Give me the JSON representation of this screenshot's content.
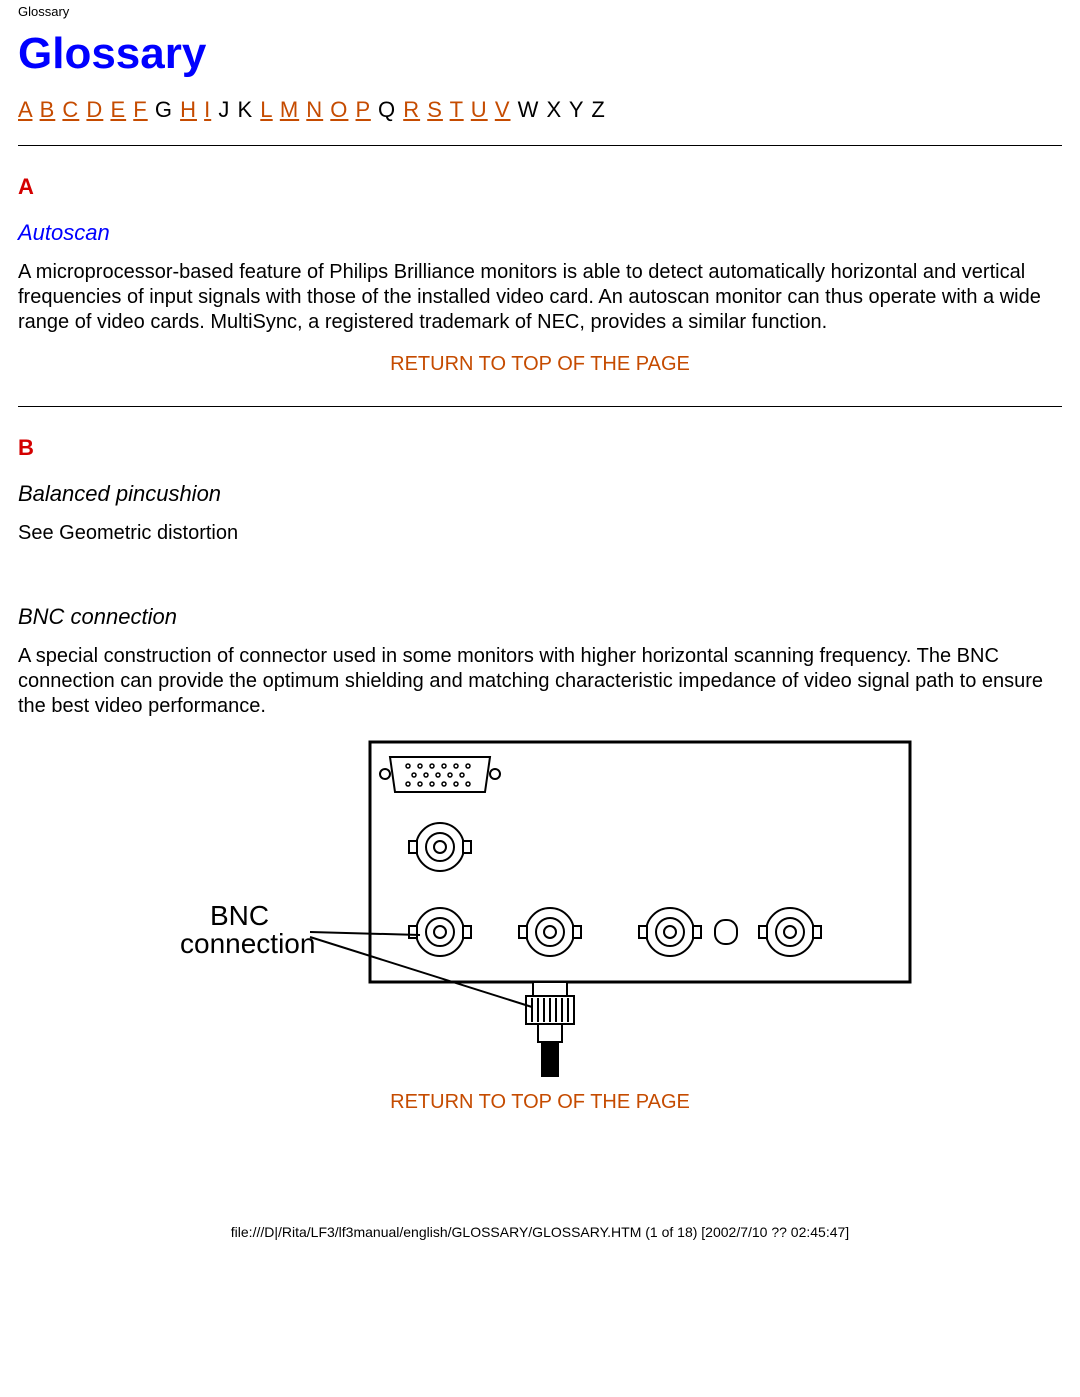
{
  "header_small": "Glossary",
  "title": "Glossary",
  "alpha_index": [
    {
      "letter": "A",
      "linked": true
    },
    {
      "letter": "B",
      "linked": true
    },
    {
      "letter": "C",
      "linked": true
    },
    {
      "letter": "D",
      "linked": true
    },
    {
      "letter": "E",
      "linked": true
    },
    {
      "letter": "F",
      "linked": true
    },
    {
      "letter": "G",
      "linked": false
    },
    {
      "letter": "H",
      "linked": true
    },
    {
      "letter": "I",
      "linked": true
    },
    {
      "letter": "J",
      "linked": false
    },
    {
      "letter": "K",
      "linked": false
    },
    {
      "letter": "L",
      "linked": true
    },
    {
      "letter": "M",
      "linked": true
    },
    {
      "letter": "N",
      "linked": true
    },
    {
      "letter": "O",
      "linked": true
    },
    {
      "letter": "P",
      "linked": true
    },
    {
      "letter": "Q",
      "linked": false
    },
    {
      "letter": "R",
      "linked": true
    },
    {
      "letter": "S",
      "linked": true
    },
    {
      "letter": "T",
      "linked": true
    },
    {
      "letter": "U",
      "linked": true
    },
    {
      "letter": "V",
      "linked": true
    },
    {
      "letter": "W",
      "linked": false
    },
    {
      "letter": "X",
      "linked": false
    },
    {
      "letter": "Y",
      "linked": false
    },
    {
      "letter": "Z",
      "linked": false
    }
  ],
  "section_a": {
    "letter": "A",
    "term1_title": "Autoscan",
    "term1_body": "A microprocessor-based feature of Philips Brilliance monitors is able to detect automatically horizontal and vertical frequencies of input signals with those of the installed video card. An autoscan monitor can thus operate with a wide range of video cards. MultiSync, a registered trademark of NEC, provides a similar function.",
    "return": "RETURN TO TOP OF THE PAGE"
  },
  "section_b": {
    "letter": "B",
    "term1_title": "Balanced pincushion",
    "term1_body": "See Geometric distortion",
    "term2_title": "BNC connection",
    "term2_body": "A special construction of connector used in some monitors with higher horizontal scanning frequency. The BNC connection can provide the optimum shielding and matching characteristic impedance of video signal path to ensure the best video performance.",
    "figure_label_line1": "BNC",
    "figure_label_line2": "connection",
    "return": "RETURN TO TOP OF THE PAGE"
  },
  "footer": "file:///D|/Rita/LF3/lf3manual/english/GLOSSARY/GLOSSARY.HTM (1 of 18) [2002/7/10 ?? 02:45:47]"
}
